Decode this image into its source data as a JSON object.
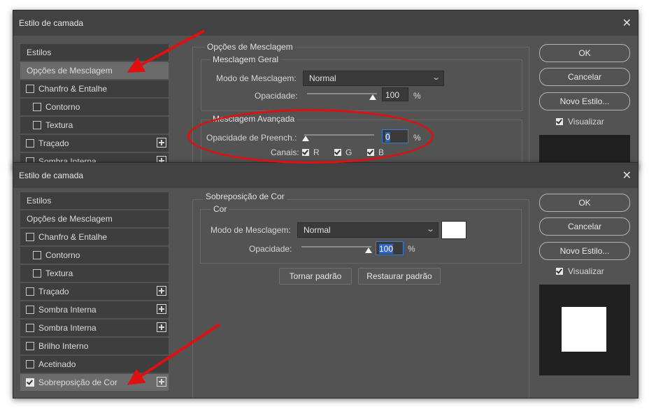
{
  "dialog_top": {
    "title": "Estilo de camada",
    "sidebar": {
      "estilos": "Estilos",
      "opcoes": "Opções de Mesclagem",
      "chanfro": "Chanfro & Entalhe",
      "contorno": "Contorno",
      "textura": "Textura",
      "tracado": "Traçado",
      "sombra_interna": "Sombra Interna"
    },
    "panel": {
      "outer_title": "Opções de Mesclagem",
      "geral_title": "Mesclagem Geral",
      "modo_label": "Modo de Mesclagem:",
      "modo_value": "Normal",
      "opacidade_label": "Opacidade:",
      "opacidade_value": "100",
      "opacidade_fraction": 1.0,
      "avancada_title": "Mesclagem Avançada",
      "preench_label": "Opacidade de Preench.:",
      "preench_value": "0",
      "preench_fraction": 0.0,
      "canais_label": "Canais:",
      "canal_r": "R",
      "canal_g": "G",
      "canal_b": "B",
      "pct": "%"
    },
    "buttons": {
      "ok": "OK",
      "cancelar": "Cancelar",
      "novo_estilo": "Novo Estilo..."
    },
    "visualizar": "Visualizar"
  },
  "dialog_bottom": {
    "title": "Estilo de camada",
    "sidebar": {
      "estilos": "Estilos",
      "opcoes": "Opções de Mesclagem",
      "chanfro": "Chanfro & Entalhe",
      "contorno": "Contorno",
      "textura": "Textura",
      "tracado": "Traçado",
      "sombra_interna_1": "Sombra Interna",
      "sombra_interna_2": "Sombra Interna",
      "brilho": "Brilho Interno",
      "acetinado": "Acetinado",
      "sobreposicao": "Sobreposição de Cor"
    },
    "panel": {
      "outer_title": "Sobreposição de Cor",
      "cor_title": "Cor",
      "modo_label": "Modo de Mesclagem:",
      "modo_value": "Normal",
      "opacidade_label": "Opacidade:",
      "opacidade_value": "100",
      "opacidade_fraction": 1.0,
      "pct": "%",
      "tornar_padrao": "Tornar padrão",
      "restaurar_padrao": "Restaurar padrão"
    },
    "buttons": {
      "ok": "OK",
      "cancelar": "Cancelar",
      "novo_estilo": "Novo Estilo..."
    },
    "visualizar": "Visualizar"
  },
  "colors": {
    "overlay_color": "#ffffff",
    "annotation_red": "#e01010",
    "dialog_bg": "#535353"
  },
  "icons": {
    "close": "close-icon",
    "add": "plus-icon",
    "dropdown": "chevron-down-icon",
    "annotation": "red-arrow-icon"
  }
}
